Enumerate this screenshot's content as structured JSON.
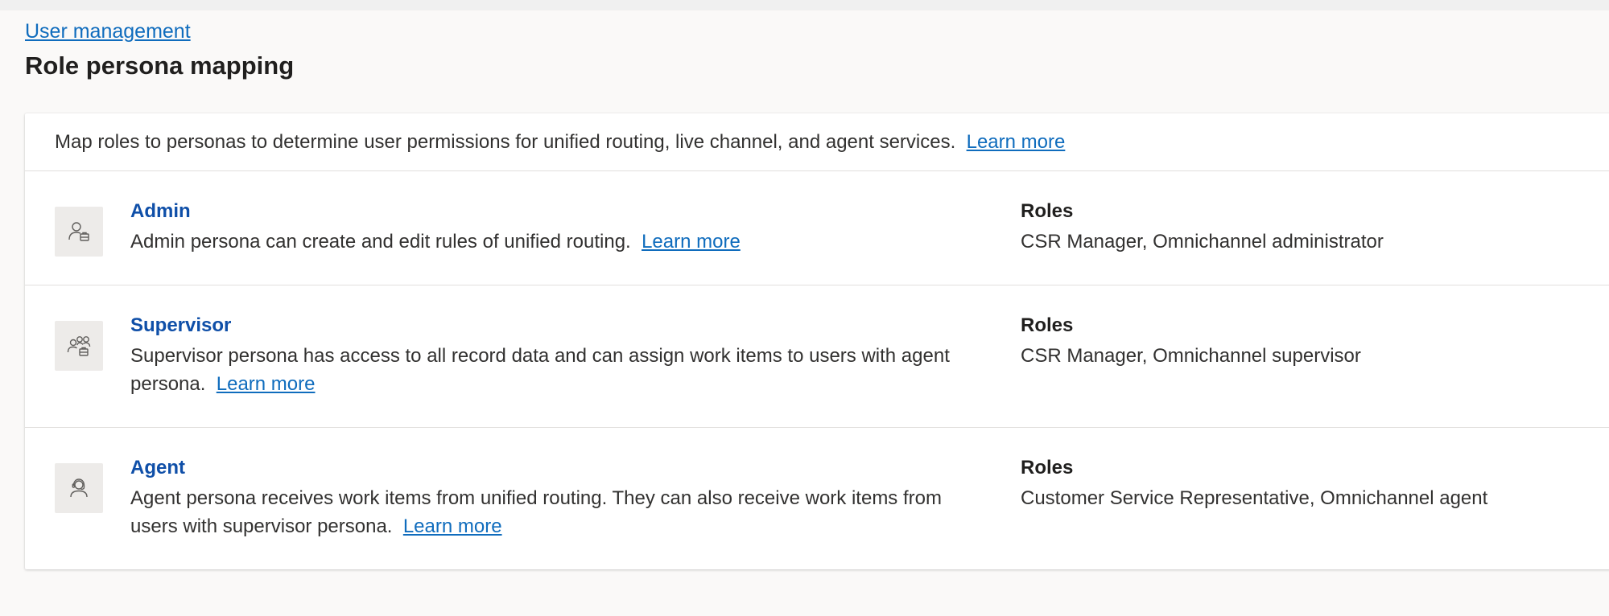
{
  "breadcrumb": {
    "label": "User management"
  },
  "page": {
    "title": "Role persona mapping"
  },
  "intro": {
    "text": "Map roles to personas to determine user permissions for unified routing, live channel, and agent services.",
    "learn_more": "Learn more"
  },
  "personas": [
    {
      "name": "Admin",
      "icon": "admin-persona-icon",
      "description": "Admin persona can create and edit rules of unified routing.",
      "learn_more": "Learn more",
      "roles_label": "Roles",
      "roles": "CSR Manager, Omnichannel administrator"
    },
    {
      "name": "Supervisor",
      "icon": "supervisor-persona-icon",
      "description": "Supervisor persona has access to all record data and can assign work items to users with agent persona.",
      "learn_more": "Learn more",
      "roles_label": "Roles",
      "roles": "CSR Manager, Omnichannel supervisor"
    },
    {
      "name": "Agent",
      "icon": "agent-persona-icon",
      "description": "Agent persona receives work items from unified routing. They can also receive work items from users with supervisor persona.",
      "learn_more": "Learn more",
      "roles_label": "Roles",
      "roles": "Customer Service Representative, Omnichannel agent"
    }
  ],
  "colors": {
    "link": "#0f6cbd",
    "persona_name": "#0f4fa8",
    "page_bg": "#faf9f8",
    "card_bg": "#ffffff",
    "icon_tile": "#edebe9"
  }
}
